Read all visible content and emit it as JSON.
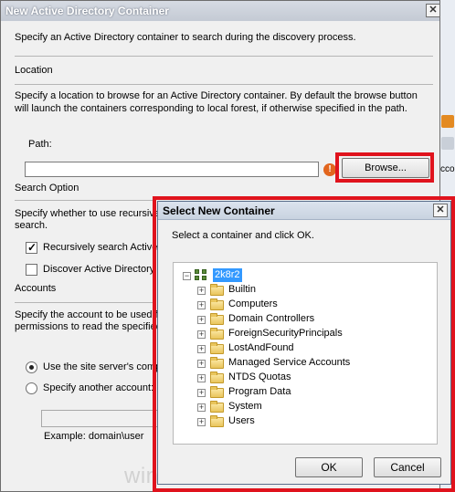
{
  "main_dialog": {
    "title": "New Active Directory Container",
    "close": "✕",
    "intro": "Specify an Active Directory container to search during the discovery process.",
    "location": {
      "heading": "Location",
      "description": "Specify a location to browse for an Active Directory container. By default the browse button will launch the containers corresponding to local forest, if otherwise specified in the path.",
      "path_label": "Path:",
      "path_value": "",
      "browse_label": "Browse..."
    },
    "search_option": {
      "heading": "Search Option",
      "description": "Specify whether to use recursive",
      "description_line2": "search.",
      "recursive_label": "Recursively search Active",
      "recursive_checked": true,
      "discover_label": "Discover Active Directory",
      "discover_checked": false
    },
    "accounts": {
      "heading": "Accounts",
      "description_line1": "Specify the account to be used f",
      "description_line2": "permissions to read the specified",
      "site_server_label": "Use the site server's compu",
      "site_server_selected": true,
      "another_label": "Specify another account:",
      "another_selected": false,
      "account_value": "",
      "example": "Example: domain\\user"
    }
  },
  "background_window": {
    "snippet": "ccou"
  },
  "select_container": {
    "title": "Select New Container",
    "close": "✕",
    "instruction": "Select a container and click OK.",
    "root": {
      "label": "2k8r2",
      "expand": "⊟"
    },
    "children": [
      {
        "label": "Builtin",
        "expand": "+"
      },
      {
        "label": "Computers",
        "expand": "+"
      },
      {
        "label": "Domain Controllers",
        "expand": "+"
      },
      {
        "label": "ForeignSecurityPrincipals",
        "expand": "+"
      },
      {
        "label": "LostAndFound",
        "expand": "+"
      },
      {
        "label": "Managed Service Accounts",
        "expand": "+"
      },
      {
        "label": "NTDS Quotas",
        "expand": "+"
      },
      {
        "label": "Program Data",
        "expand": "+"
      },
      {
        "label": "System",
        "expand": "+"
      },
      {
        "label": "Users",
        "expand": "+"
      }
    ],
    "ok_label": "OK",
    "cancel_label": "Cancel"
  },
  "watermark": "windows-noob.com",
  "colors": {
    "highlight_red": "#e0131d",
    "selection_blue": "#3399ff",
    "error_orange": "#e2651d"
  }
}
